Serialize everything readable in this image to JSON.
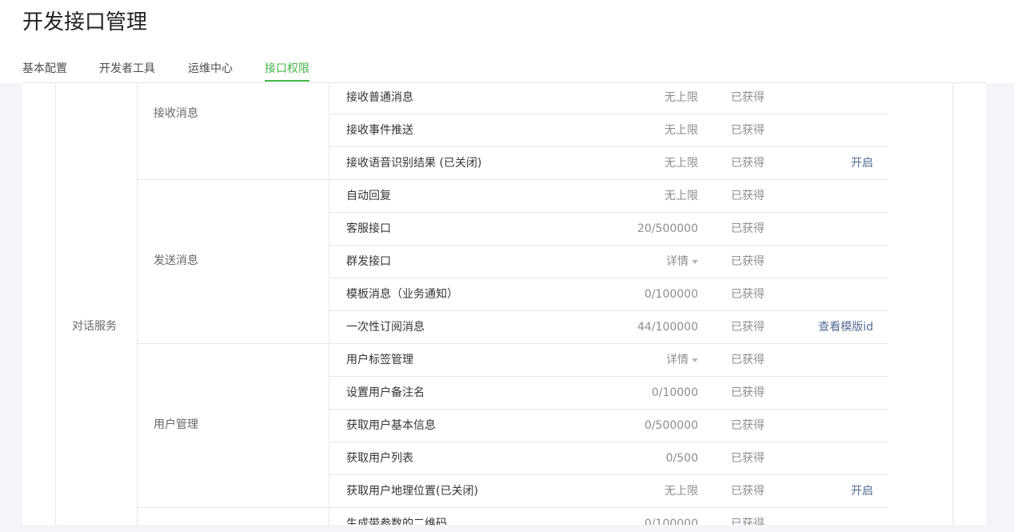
{
  "page_title": "开发接口管理",
  "tabs": [
    {
      "label": "基本配置"
    },
    {
      "label": "开发者工具"
    },
    {
      "label": "运维中心"
    },
    {
      "label": "接口权限"
    }
  ],
  "active_tab": "接口权限",
  "accent_color": "#44b549",
  "link_color": "#576b95",
  "category": "对话服务",
  "groups": [
    {
      "name": "接收消息"
    },
    {
      "name": "发送消息"
    },
    {
      "name": "用户管理"
    }
  ],
  "rows": [
    {
      "name": "接收普通消息",
      "quota": "无上限",
      "status": "已获得",
      "action": ""
    },
    {
      "name": "接收事件推送",
      "quota": "无上限",
      "status": "已获得",
      "action": ""
    },
    {
      "name": "接收语音识别结果 (已关闭)",
      "quota": "无上限",
      "status": "已获得",
      "action": "开启"
    },
    {
      "name": "自动回复",
      "quota": "无上限",
      "status": "已获得",
      "action": ""
    },
    {
      "name": "客服接口",
      "quota": "20/500000",
      "status": "已获得",
      "action": ""
    },
    {
      "name": "群发接口",
      "quota": "详情",
      "status": "已获得",
      "action": ""
    },
    {
      "name": "模板消息（业务通知）",
      "quota": "0/100000",
      "status": "已获得",
      "action": ""
    },
    {
      "name": "一次性订阅消息",
      "quota": "44/100000",
      "status": "已获得",
      "action": "查看模版id"
    },
    {
      "name": "用户标签管理",
      "quota": "详情",
      "status": "已获得",
      "action": ""
    },
    {
      "name": "设置用户备注名",
      "quota": "0/10000",
      "status": "已获得",
      "action": ""
    },
    {
      "name": "获取用户基本信息",
      "quota": "0/500000",
      "status": "已获得",
      "action": ""
    },
    {
      "name": "获取用户列表",
      "quota": "0/500",
      "status": "已获得",
      "action": ""
    },
    {
      "name": "获取用户地理位置(已关闭)",
      "quota": "无上限",
      "status": "已获得",
      "action": "开启"
    },
    {
      "name": "生成带参数的二维码",
      "quota": "0/100000",
      "status": "已获得",
      "action": ""
    }
  ]
}
